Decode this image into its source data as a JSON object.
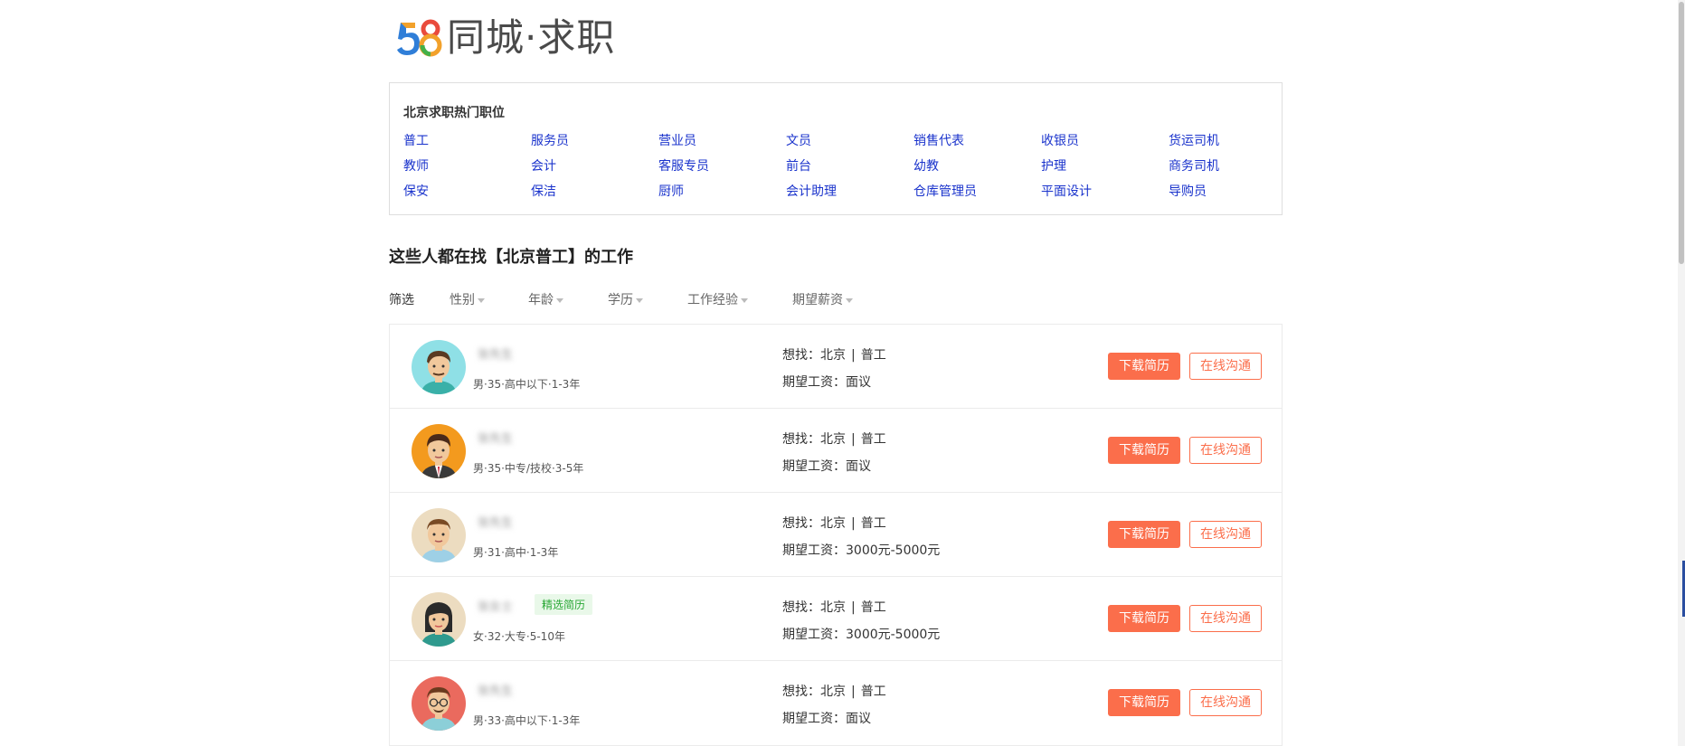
{
  "logo": {
    "mark_digits": "58",
    "text": "同城·求职"
  },
  "hot_jobs": {
    "title": "北京求职热门职位",
    "links": [
      "普工",
      "服务员",
      "营业员",
      "文员",
      "销售代表",
      "收银员",
      "货运司机",
      "教师",
      "会计",
      "客服专员",
      "前台",
      "幼教",
      "护理",
      "商务司机",
      "保安",
      "保洁",
      "厨师",
      "会计助理",
      "仓库管理员",
      "平面设计",
      "导购员"
    ]
  },
  "section_title": "这些人都在找【北京普工】的工作",
  "filters": {
    "label": "筛选",
    "items": [
      "性别",
      "年龄",
      "学历",
      "工作经验",
      "期望薪资"
    ]
  },
  "buttons": {
    "download": "下载简历",
    "chat": "在线沟通"
  },
  "rows": [
    {
      "name": "张先生",
      "badge": "",
      "meta": "男·35·高中以下·1-3年",
      "want_prefix": "想找：北京",
      "want_job": "普工",
      "salary": "期望工资：面议",
      "avatar": "man-teal-icon"
    },
    {
      "name": "张先生",
      "badge": "",
      "meta": "男·35·中专/技校·3-5年",
      "want_prefix": "想找：北京",
      "want_job": "普工",
      "salary": "期望工资：面议",
      "avatar": "man-suit-orange-icon"
    },
    {
      "name": "张先生",
      "badge": "",
      "meta": "男·31·高中·1-3年",
      "want_prefix": "想找：北京",
      "want_job": "普工",
      "salary": "期望工资：3000元-5000元",
      "avatar": "man-beige-icon"
    },
    {
      "name": "张女士",
      "badge": "精选简历",
      "meta": "女·32·大专·5-10年",
      "want_prefix": "想找：北京",
      "want_job": "普工",
      "salary": "期望工资：3000元-5000元",
      "avatar": "woman-beige-icon"
    },
    {
      "name": "张先生",
      "badge": "",
      "meta": "男·33·高中以下·1-3年",
      "want_prefix": "想找：北京",
      "want_job": "普工",
      "salary": "期望工资：面议",
      "avatar": "man-glasses-red-icon"
    }
  ],
  "colors": {
    "accent": "#fb6e4b",
    "link": "#1a33cc",
    "badge_bg": "#e9f8e9",
    "badge_text": "#2aa836"
  }
}
